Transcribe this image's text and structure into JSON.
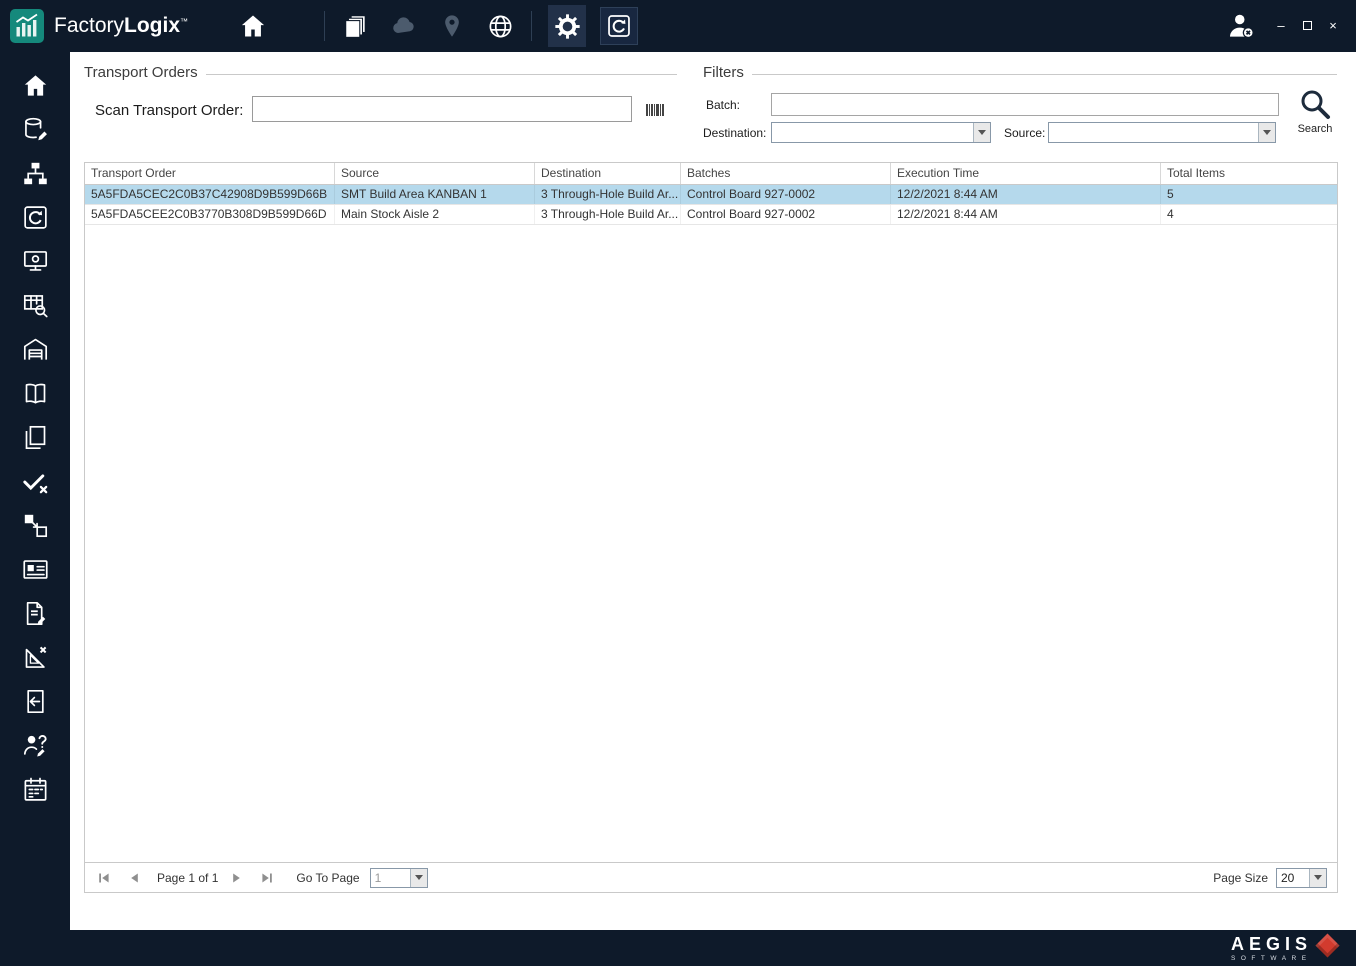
{
  "topbar": {
    "brand_factory": "Factory",
    "brand_logix": "Logix",
    "brand_tm": "™",
    "window": {
      "minimize": "–",
      "close": "×"
    }
  },
  "sidebar": {
    "icons": [
      "home",
      "database-edit",
      "workflow",
      "history",
      "monitor",
      "table-search",
      "warehouse",
      "library",
      "copy",
      "verify",
      "move",
      "id-card",
      "document-edit",
      "design-ruler",
      "document-import",
      "user-question",
      "schedule"
    ]
  },
  "transport_orders": {
    "title": "Transport Orders",
    "scan_label": "Scan Transport Order:",
    "scan_value": ""
  },
  "filters": {
    "title": "Filters",
    "batch_label": "Batch:",
    "batch_value": "",
    "destination_label": "Destination:",
    "destination_value": "",
    "source_label": "Source:",
    "source_value": "",
    "search_label": "Search"
  },
  "table": {
    "columns": [
      "Transport Order",
      "Source",
      "Destination",
      "Batches",
      "Execution Time",
      "Total Items"
    ],
    "rows": [
      {
        "transport_order": "5A5FDA5CEC2C0B37C42908D9B599D66B",
        "source": "SMT Build Area KANBAN 1",
        "destination": "3 Through-Hole Build Ar...",
        "batches": "Control Board 927-0002",
        "execution_time": "12/2/2021 8:44 AM",
        "total_items": "5",
        "selected": true
      },
      {
        "transport_order": "5A5FDA5CEE2C0B3770B308D9B599D66D",
        "source": "Main Stock Aisle 2",
        "destination": "3 Through-Hole Build Ar...",
        "batches": "Control Board 927-0002",
        "execution_time": "12/2/2021 8:44 AM",
        "total_items": "4",
        "selected": false
      }
    ]
  },
  "pagination": {
    "page_text": "Page 1 of 1",
    "go_to_page_label": "Go To Page",
    "go_to_page_value": "1",
    "page_size_label": "Page Size",
    "page_size_value": "20"
  },
  "footer": {
    "brand": "AEGIS",
    "brand_sub": "SOFTWARE"
  },
  "colors": {
    "topbar_bg": "#0e1a2a",
    "accent_teal": "#15897c",
    "selected_row": "#b5d9ec",
    "aegis_red": "#d23b2e"
  }
}
